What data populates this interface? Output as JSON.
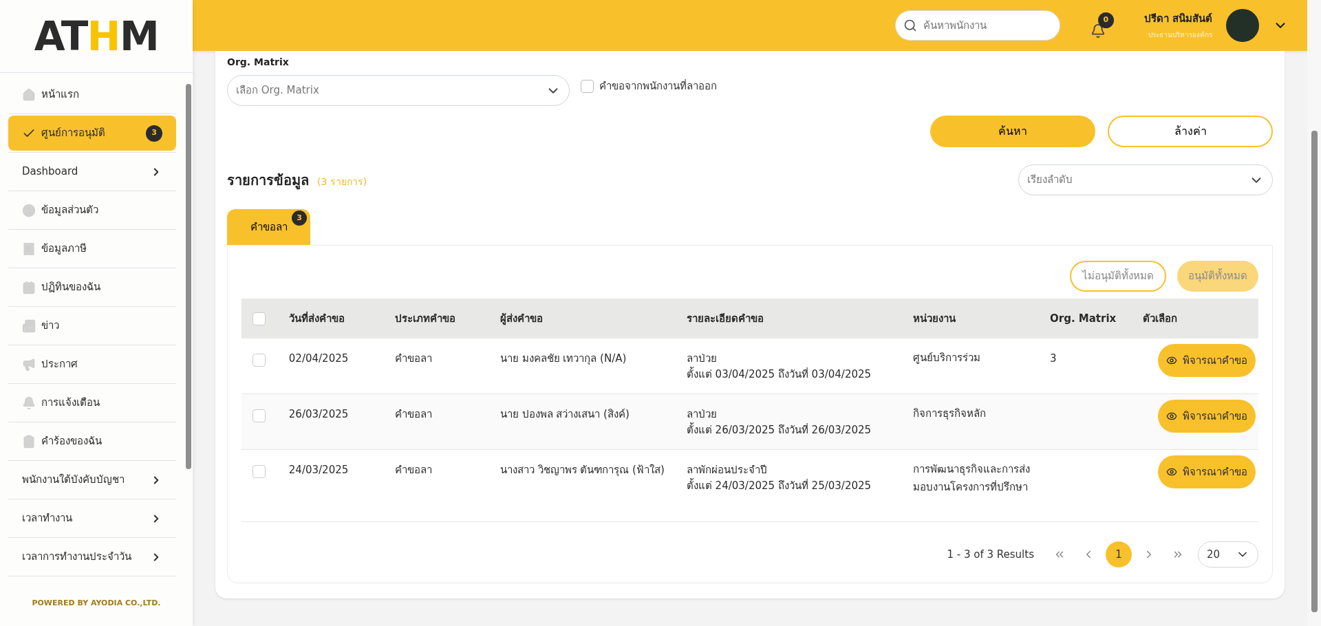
{
  "logo": {
    "parts": [
      {
        "text": "AT",
        "accent": false
      },
      {
        "text": "H",
        "accent": true
      },
      {
        "text": "M",
        "accent": false
      }
    ]
  },
  "sidebar": {
    "items": [
      {
        "label": "หน้าแรก",
        "kind": "page",
        "selected": false
      },
      {
        "label": "ศูนย์การอนุมัติ",
        "kind": "page",
        "selected": true,
        "badge": "3"
      },
      {
        "label": "Dashboard",
        "kind": "group",
        "selected": false
      },
      {
        "label": "ข้อมูลส่วนตัว",
        "kind": "page",
        "selected": false
      },
      {
        "label": "ข้อมูลภาษี",
        "kind": "page",
        "selected": false
      },
      {
        "label": "ปฏิทินของฉัน",
        "kind": "page",
        "selected": false
      },
      {
        "label": "ข่าว",
        "kind": "page",
        "selected": false
      },
      {
        "label": "ประกาศ",
        "kind": "page",
        "selected": false
      },
      {
        "label": "การแจ้งเตือน",
        "kind": "page",
        "selected": false
      },
      {
        "label": "คำร้องของฉัน",
        "kind": "page",
        "selected": false
      },
      {
        "label": "พนักงานใต้บังคับบัญชา",
        "kind": "group",
        "selected": false
      },
      {
        "label": "เวลาทำงาน",
        "kind": "group",
        "selected": false
      },
      {
        "label": "เวลาการทำงานประจำวัน",
        "kind": "group",
        "selected": false
      }
    ],
    "footer": "POWERED BY AYODIA CO.,LTD."
  },
  "header": {
    "search": {
      "placeholder": "ค้นหาพนักงาน"
    },
    "notifications": "0",
    "user": {
      "name": "ปรีดา สนิมสันต์",
      "role": "ประธานบริหารองค์กร"
    }
  },
  "filters": {
    "org_matrix": {
      "label": "Org. Matrix",
      "placeholder": "เลือก Org. Matrix"
    },
    "resigned_checkbox": {
      "label": "คำขอจากพนักงานที่ลาออก",
      "checked": false
    },
    "buttons": [
      "ค้นหา",
      "ล้างค่า"
    ]
  },
  "list": {
    "title": "รายการข้อมูล",
    "count": "(3 รายการ)",
    "sort": {
      "placeholder": "เรียงลำดับ"
    },
    "tabs": [
      {
        "label": "คำขอลา",
        "selected": true,
        "badge": "3"
      }
    ],
    "bulk_buttons": [
      {
        "label": "ไม่อนุมัติทั้งหมด",
        "kind": "reject"
      },
      {
        "label": "อนุมัติทั้งหมด",
        "kind": "approve"
      }
    ],
    "table": {
      "select_all": false,
      "columns": [
        "วันที่ส่งคำขอ",
        "ประเภทคำขอ",
        "ผู้ส่งคำขอ",
        "รายละเอียดคำขอ",
        "หน่วยงาน",
        "Org. Matrix",
        "ตัวเลือก"
      ],
      "rows": [
        {
          "checked": false,
          "date": "02/04/2025",
          "type": "คำขอลา",
          "sender": "นาย มงคลชัย เทวากุล (N/A)",
          "detail": [
            "ลาป่วย",
            "ตั้งแต่ 03/04/2025 ถึงวันที่ 03/04/2025"
          ],
          "unit": "ศูนย์บริการร่วม",
          "org_matrix": "3",
          "action": "พิจารณาคำขอ"
        },
        {
          "checked": false,
          "date": "26/03/2025",
          "type": "คำขอลา",
          "sender": "นาย ปองพล สว่างเสนา (สิงค์)",
          "detail": [
            "ลาป่วย",
            "ตั้งแต่ 26/03/2025 ถึงวันที่ 26/03/2025"
          ],
          "unit": "กิจการธุรกิจหลัก",
          "action": "พิจารณาคำขอ"
        },
        {
          "checked": false,
          "date": "24/03/2025",
          "type": "คำขอลา",
          "sender": "นางสาว วิชญาพร ตันฑการุณ (ฟ้าใส)",
          "detail": [
            "ลาพักผ่อนประจำปี",
            "ตั้งแต่ 24/03/2025 ถึงวันที่ 25/03/2025"
          ],
          "unit": "การพัฒนาธุรกิจและการส่งมอบงานโครงการที่ปรึกษา",
          "action": "พิจารณาคำขอ"
        }
      ]
    },
    "pagination": {
      "summary": "1 - 3 of 3 Results",
      "pages": [
        {
          "label": "1",
          "selected": true
        }
      ],
      "page_size": "20"
    }
  }
}
